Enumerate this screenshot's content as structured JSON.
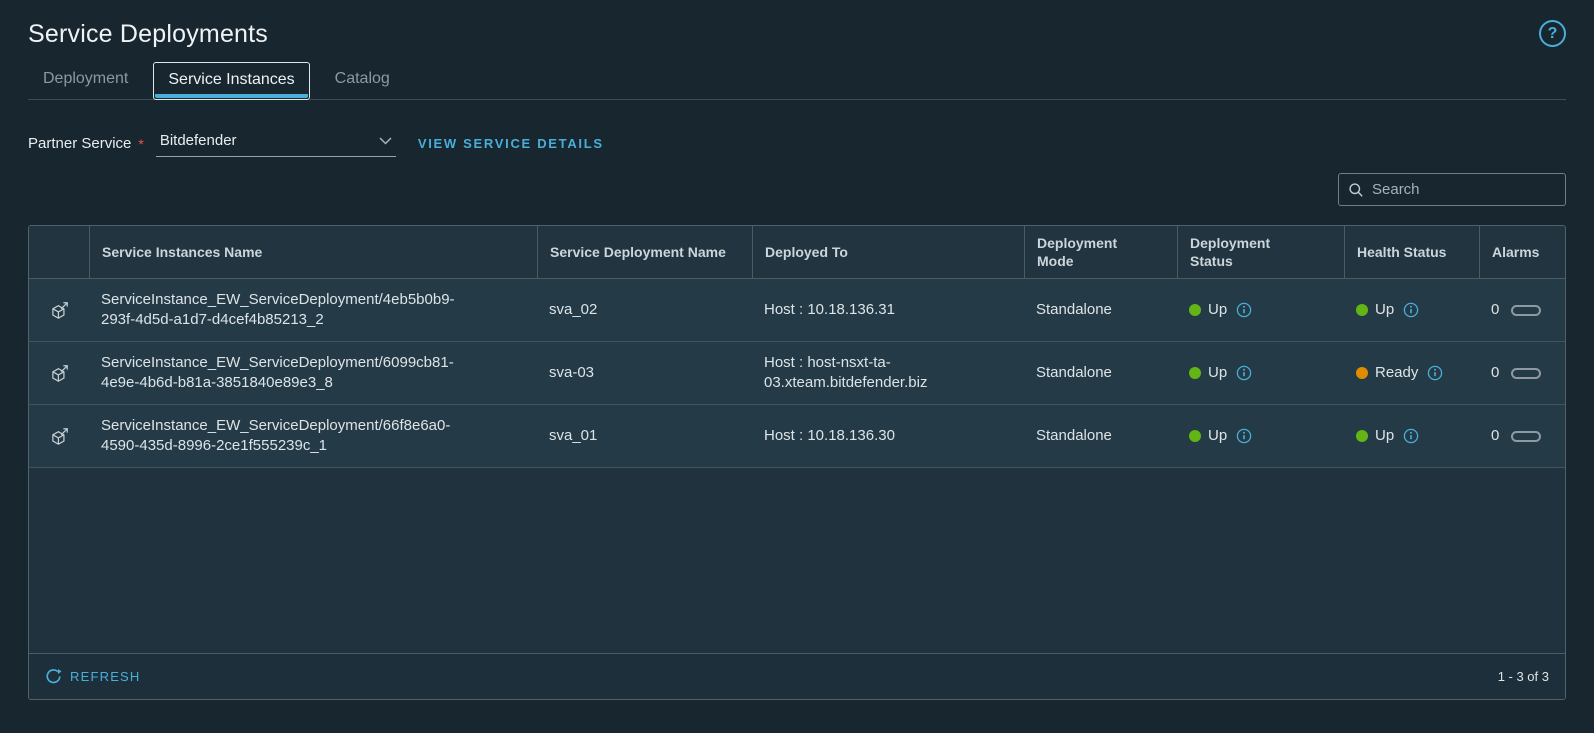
{
  "page": {
    "title": "Service Deployments"
  },
  "icons": {
    "help_glyph": "?"
  },
  "tabs": {
    "items": [
      {
        "label": "Deployment"
      },
      {
        "label": "Service Instances"
      },
      {
        "label": "Catalog"
      }
    ],
    "active": "Service Instances"
  },
  "filter": {
    "label": "Partner Service",
    "required_marker": "*",
    "value": "Bitdefender",
    "action_link": "VIEW SERVICE DETAILS"
  },
  "search": {
    "placeholder": "Search"
  },
  "table": {
    "headers": {
      "name": "Service Instances Name",
      "deployment_name": "Service Deployment Name",
      "deployed_to": "Deployed To",
      "mode": "Deployment Mode",
      "status": "Deployment Status",
      "health": "Health Status",
      "alarms": "Alarms"
    },
    "rows": [
      {
        "name": "ServiceInstance_EW_ServiceDeployment/4eb5b0b9-293f-4d5d-a1d7-d4cef4b85213_2",
        "deployment_name": "sva_02",
        "deployed_to": "Host : 10.18.136.31",
        "mode": "Standalone",
        "status": {
          "label": "Up",
          "color": "#62b515"
        },
        "health": {
          "label": "Up",
          "color": "#62b515"
        },
        "alarms": "0"
      },
      {
        "name": "ServiceInstance_EW_ServiceDeployment/6099cb81-4e9e-4b6d-b81a-3851840e89e3_8",
        "deployment_name": "sva-03",
        "deployed_to": "Host : host-nsxt-ta-03.xteam.bitdefender.biz",
        "mode": "Standalone",
        "status": {
          "label": "Up",
          "color": "#62b515"
        },
        "health": {
          "label": "Ready",
          "color": "#e08c00"
        },
        "alarms": "0"
      },
      {
        "name": "ServiceInstance_EW_ServiceDeployment/66f8e6a0-4590-435d-8996-2ce1f555239c_1",
        "deployment_name": "sva_01",
        "deployed_to": "Host : 10.18.136.30",
        "mode": "Standalone",
        "status": {
          "label": "Up",
          "color": "#62b515"
        },
        "health": {
          "label": "Up",
          "color": "#62b515"
        },
        "alarms": "0"
      }
    ],
    "footer": {
      "refresh": "REFRESH",
      "range": "1 - 3 of 3"
    }
  },
  "colors": {
    "accent_blue": "#49afd9",
    "status_up_green": "#62b515",
    "status_ready_orange": "#e08c00",
    "required_red": "#f55047"
  }
}
